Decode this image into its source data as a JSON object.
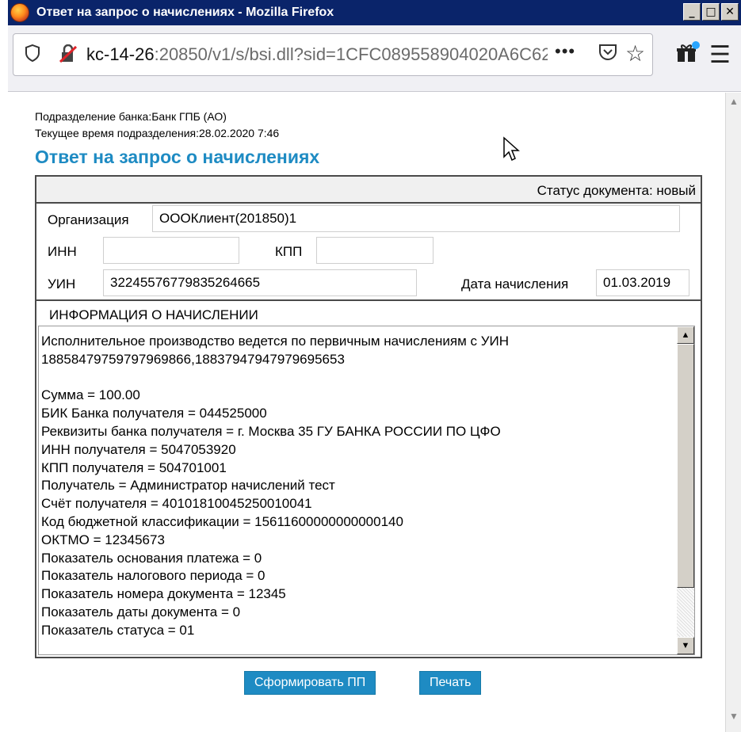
{
  "window": {
    "title": "Ответ на запрос о начислениях - Mozilla Firefox",
    "minimize_glyph": "_",
    "maximize_glyph": "□",
    "close_glyph": "✕"
  },
  "browser": {
    "url_host": "kc-14-26",
    "url_rest": ":20850/v1/s/bsi.dll?sid=1CFC089558904020A6C62!",
    "icons": {
      "shield": "shield-icon",
      "lock": "insecure-lock-icon",
      "page_actions": "•••",
      "pocket": "pocket-icon",
      "bookmark": "star-icon",
      "whats_new": "gift-icon",
      "menu": "hamburger-icon"
    }
  },
  "page": {
    "branch": "Подразделение банка:Банк ГПБ (АО)",
    "current_time": "Текущее время подразделения:28.02.2020 7:46",
    "title": "Ответ на запрос о начислениях",
    "status": "Статус документа: новый",
    "form": {
      "org_label": "Организация",
      "org_value": "OOOКлиент(201850)1",
      "inn_label": "ИНН",
      "inn_value": "",
      "kpp_label": "КПП",
      "kpp_value": "",
      "uin_label": "УИН",
      "uin_value": "32245576779835264665",
      "date_label": "Дата начисления",
      "date_value": "01.03.2019"
    },
    "info_section_title": "ИНФОРМАЦИЯ О НАЧИСЛЕНИИ",
    "info_lines": [
      "Исполнительное производство ведется по первичным начислениям с УИН",
      "18858479759797969866,18837947947979695653",
      "",
      "Сумма = 100.00",
      "БИК Банка получателя = 044525000",
      "Реквизиты банка получателя = г. Москва 35 ГУ БАНКА РОССИИ ПО ЦФО",
      "ИНН получателя = 5047053920",
      "КПП получателя = 504701001",
      "Получатель = Администратор начислений тест",
      "Счёт получателя = 40101810045250010041",
      "Код бюджетной классификации = 15611600000000000140",
      "ОКТМО = 12345673",
      "Показатель основания платежа = 0",
      "Показатель налогового периода = 0",
      "Показатель номера документа = 12345",
      "Показатель даты документа = 0",
      "Показатель статуса = 01"
    ],
    "buttons": {
      "create_pp": "Сформировать ПП",
      "print": "Печать"
    }
  }
}
